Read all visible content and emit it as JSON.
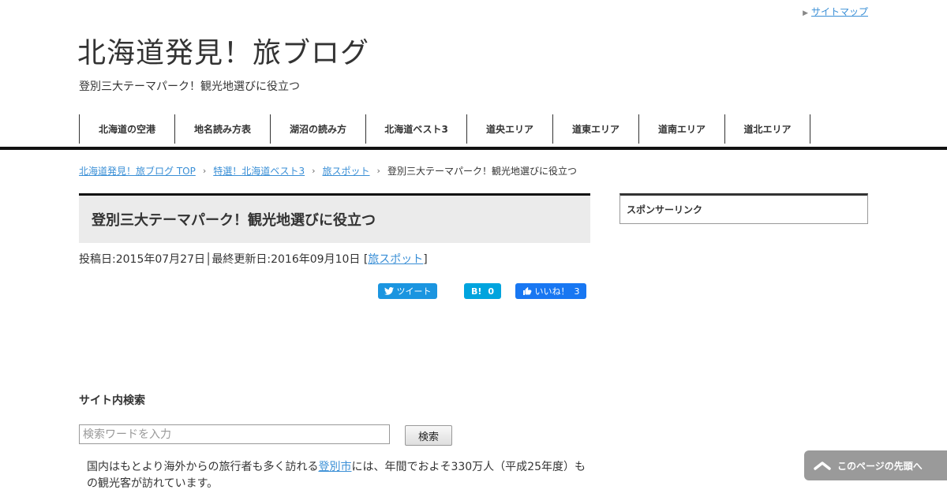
{
  "header": {
    "sitemap_link": "サイトマップ",
    "site_title": "北海道発見！旅ブログ",
    "tagline": "登別三大テーマパーク！観光地選びに役立つ"
  },
  "global_nav": {
    "items": [
      {
        "label": "北海道の空港"
      },
      {
        "label": "地名読み方表"
      },
      {
        "label": "湖沼の読み方"
      },
      {
        "label": "北海道ベスト3"
      },
      {
        "label": "道央エリア"
      },
      {
        "label": "道東エリア"
      },
      {
        "label": "道南エリア"
      },
      {
        "label": "道北エリア"
      }
    ]
  },
  "breadcrumb": {
    "home": "北海道発見！旅ブログ TOP",
    "level1": "特選！北海道ベスト3",
    "level2": "旅スポット",
    "current": "登別三大テーマパーク！観光地選びに役立つ",
    "separator": "›"
  },
  "post": {
    "title": "登別三大テーマパーク！観光地選びに役立つ",
    "meta_prefix": "投稿日:2015年07月27日│最終更新日:2016年09月10日 [",
    "category": "旅スポット",
    "meta_suffix": "]"
  },
  "share": {
    "twitter_label": "ツイート",
    "hatena_label": "B!",
    "hatena_count": "0",
    "facebook_label": "いいね！",
    "facebook_count": "3",
    "twitter_color": "#1b95e0",
    "hatena_color": "#00a4de",
    "facebook_color": "#1877f2"
  },
  "sidebar": {
    "sponsor_title": "スポンサーリンク"
  },
  "search": {
    "heading": "サイト内検索",
    "placeholder": "検索ワードを入力",
    "button_label": "検索"
  },
  "body": {
    "text_before_link": "国内はもとより海外からの旅行者も多く訪れる",
    "link_text": "登別市",
    "text_after_link": "には、年間でおよそ330万人（平成25年度）もの観光客が訪れています。"
  },
  "back_to_top": {
    "label": "このページの先頭へ"
  },
  "colors": {
    "link": "#3a8fd6",
    "title_box_bg": "#ebebeb",
    "back_to_top_bg": "#9a9a9a"
  }
}
